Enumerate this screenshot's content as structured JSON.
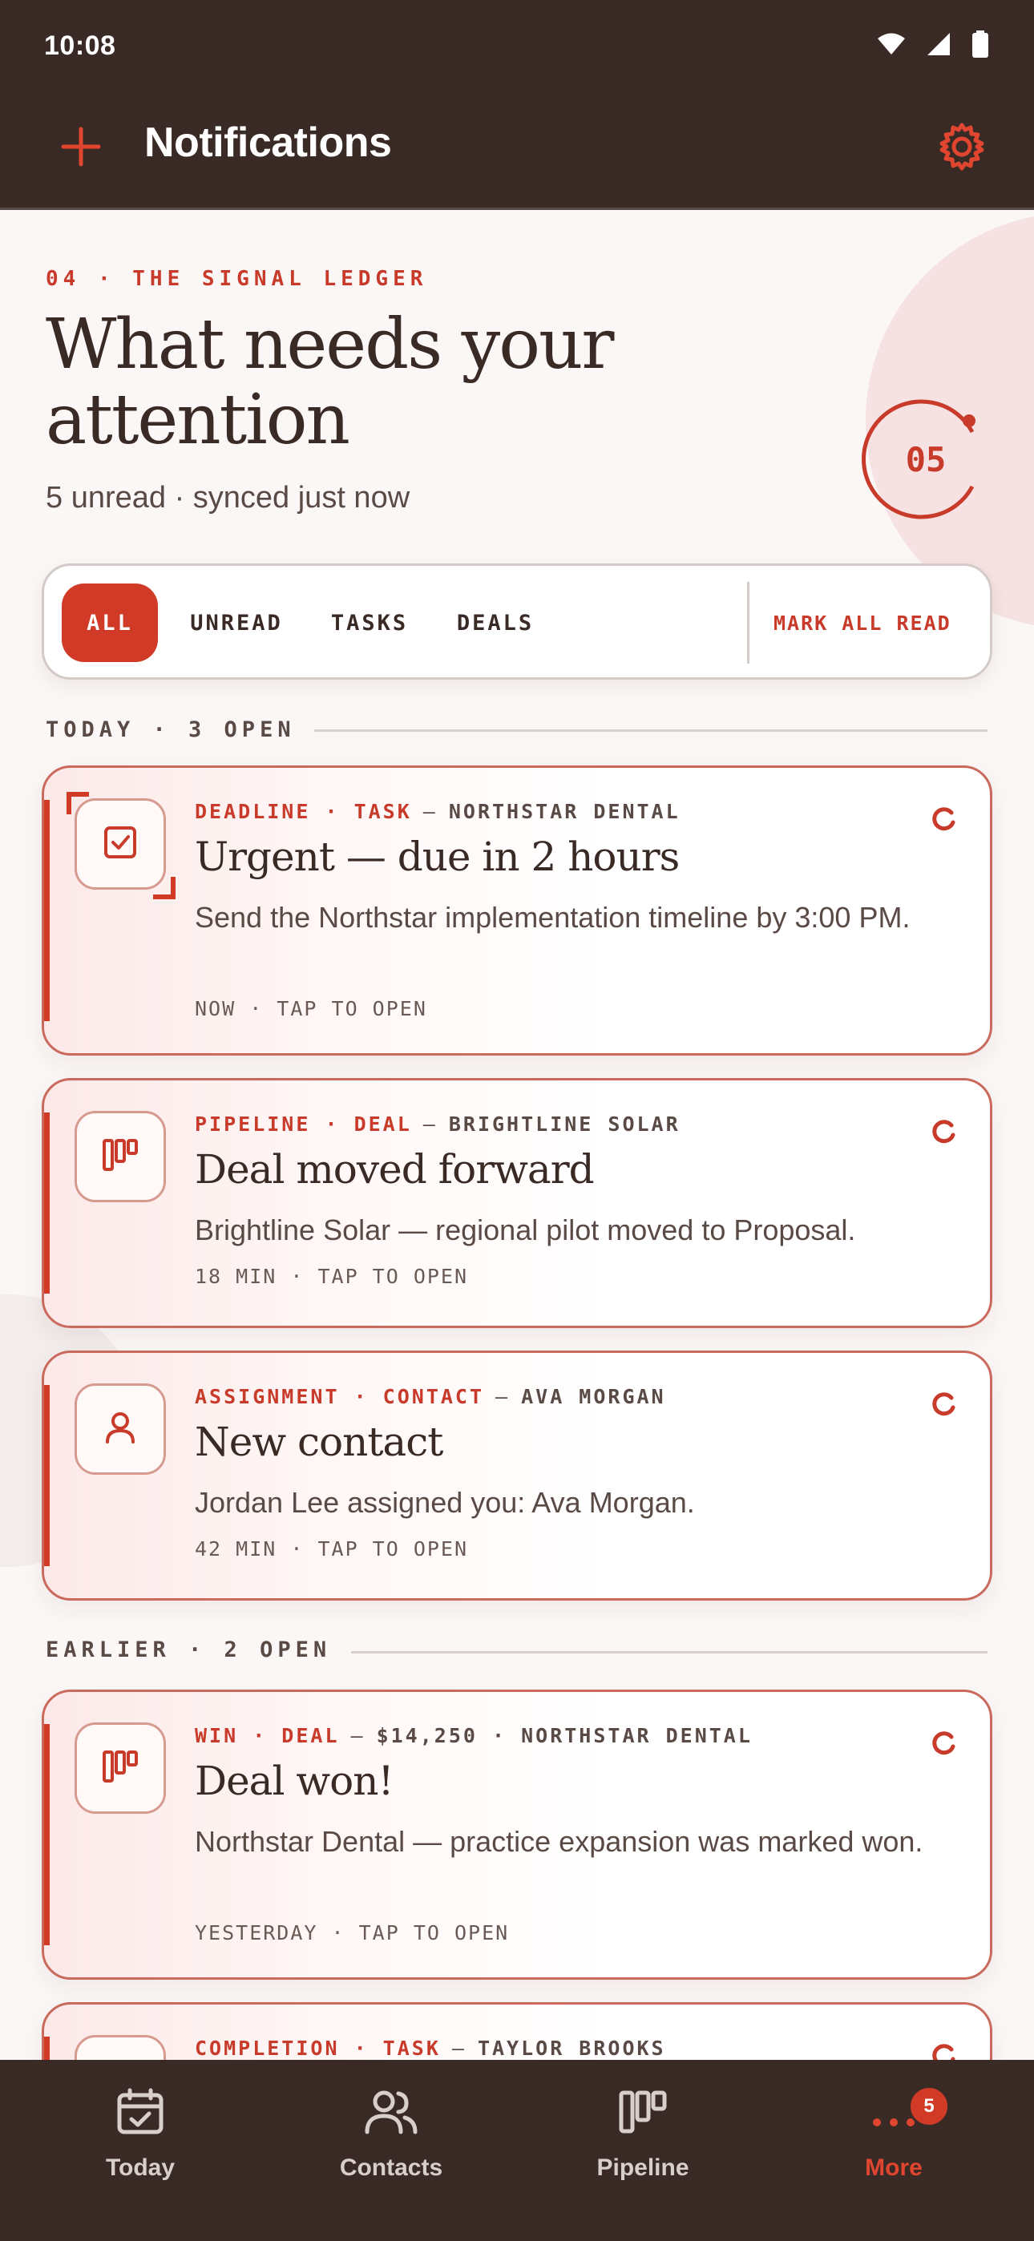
{
  "status_bar": {
    "time": "10:08"
  },
  "app_bar": {
    "title": "Notifications"
  },
  "hero": {
    "kicker": "04 · THE SIGNAL LEDGER",
    "headline_line1": "What needs your",
    "headline_line2": "attention",
    "subline": "5 unread · synced just now",
    "counter": "05"
  },
  "filters": {
    "items": [
      "ALL",
      "UNREAD",
      "TASKS",
      "DEALS"
    ],
    "selected": "ALL",
    "mark_all": "MARK ALL READ"
  },
  "sections": [
    {
      "label": "TODAY · 3 OPEN"
    },
    {
      "label": "EARLIER · 2 OPEN"
    }
  ],
  "notifications": [
    {
      "tag": "DEADLINE · TASK",
      "entity": "NORTHSTAR DENTAL",
      "title": "Urgent — due in 2 hours",
      "body": "Send the Northstar implementation timeline by 3:00 PM.",
      "footer": "NOW · TAP TO OPEN",
      "icon": "task-check-icon"
    },
    {
      "tag": "PIPELINE · DEAL",
      "entity": "BRIGHTLINE SOLAR",
      "title": "Deal moved forward",
      "body": "Brightline Solar — regional pilot moved to Proposal.",
      "footer": "18 MIN · TAP TO OPEN",
      "icon": "pipeline-icon"
    },
    {
      "tag": "ASSIGNMENT · CONTACT",
      "entity": "AVA MORGAN",
      "title": "New contact",
      "body": "Jordan Lee assigned you: Ava Morgan.",
      "footer": "42 MIN · TAP TO OPEN",
      "icon": "person-icon"
    },
    {
      "tag": "WIN · DEAL",
      "entity": "$14,250 · NORTHSTAR DENTAL",
      "title": "Deal won!",
      "body": "Northstar Dental — practice expansion was marked won.",
      "footer": "YESTERDAY · TAP TO OPEN",
      "icon": "pipeline-icon"
    },
    {
      "tag": "COMPLETION · TASK",
      "entity": "TAYLOR BROOKS",
      "title": "",
      "body": "",
      "footer": "",
      "icon": "task-check-icon"
    }
  ],
  "bottom_nav": {
    "items": [
      {
        "label": "Today",
        "icon": "calendar-icon"
      },
      {
        "label": "Contacts",
        "icon": "contacts-icon"
      },
      {
        "label": "Pipeline",
        "icon": "pipeline-icon"
      },
      {
        "label": "More",
        "icon": "more-icon"
      }
    ],
    "active": "More",
    "more_badge": "5"
  },
  "colors": {
    "accent": "#d03a26",
    "dark": "#3a2a25",
    "background": "#fbf7f7"
  }
}
